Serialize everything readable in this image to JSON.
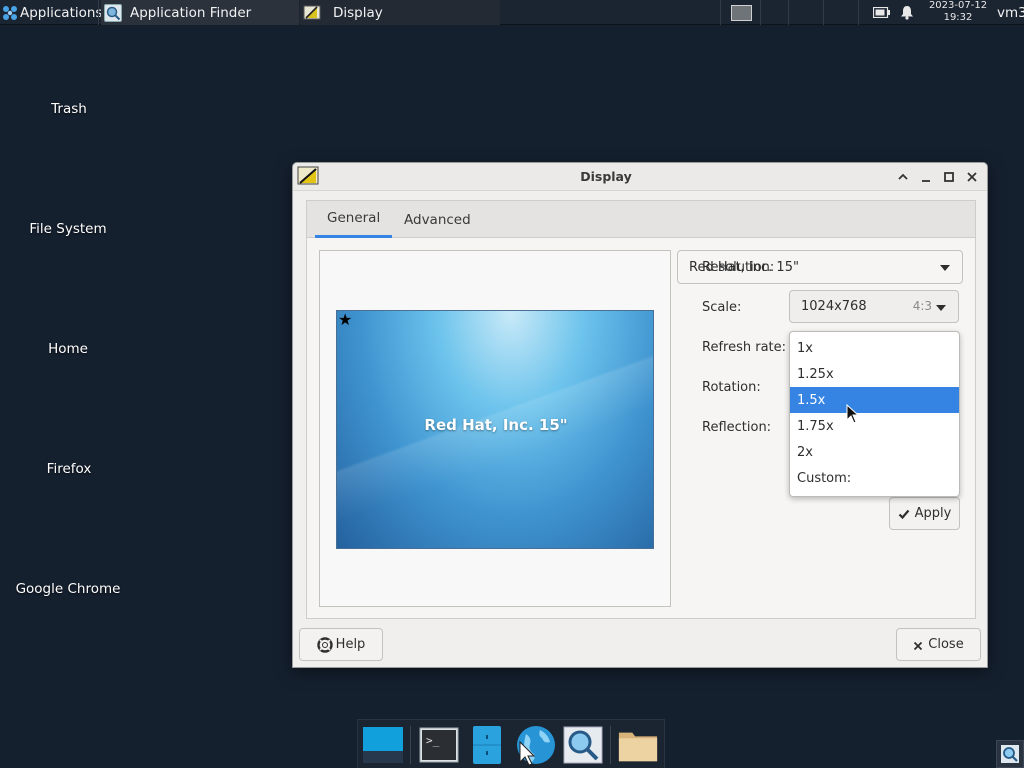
{
  "top_panel": {
    "applications_label": "Applications",
    "tasks": [
      {
        "label": "Application Finder",
        "icon": "search-icon"
      },
      {
        "label": "Display",
        "icon": "display-settings-icon"
      }
    ],
    "clock": {
      "date": "2023-07-12",
      "time": "19:32"
    },
    "user": "vm3"
  },
  "desktop_icons": [
    {
      "label": "Trash"
    },
    {
      "label": "File System"
    },
    {
      "label": "Home"
    },
    {
      "label": "Firefox"
    },
    {
      "label": "Google Chrome"
    }
  ],
  "dialog": {
    "title": "Display",
    "tabs": [
      {
        "label": "General",
        "active": true
      },
      {
        "label": "Advanced",
        "active": false
      }
    ],
    "monitor_select": "Red Hat, Inc. 15\"",
    "preview_label": "Red Hat, Inc. 15\"",
    "primary_marker": "★",
    "labels": {
      "resolution": "Resolution:",
      "scale": "Scale:",
      "refresh_rate": "Refresh rate:",
      "rotation": "Rotation:",
      "reflection": "Reflection:"
    },
    "resolution": {
      "value": "1024x768",
      "ratio": "4:3"
    },
    "scale_options": [
      "1x",
      "1.25x",
      "1.5x",
      "1.75x",
      "2x",
      "Custom:"
    ],
    "scale_selected": "1.5x",
    "apply_label": "Apply",
    "help_label": "Help",
    "close_label": "Close"
  },
  "colors": {
    "desktop_bg": "#15202f",
    "accent": "#3584e4"
  },
  "dock_items": [
    "show-desktop-icon",
    "terminal-icon",
    "file-manager-icon",
    "web-browser-icon",
    "app-finder-icon",
    "home-folder-icon"
  ]
}
